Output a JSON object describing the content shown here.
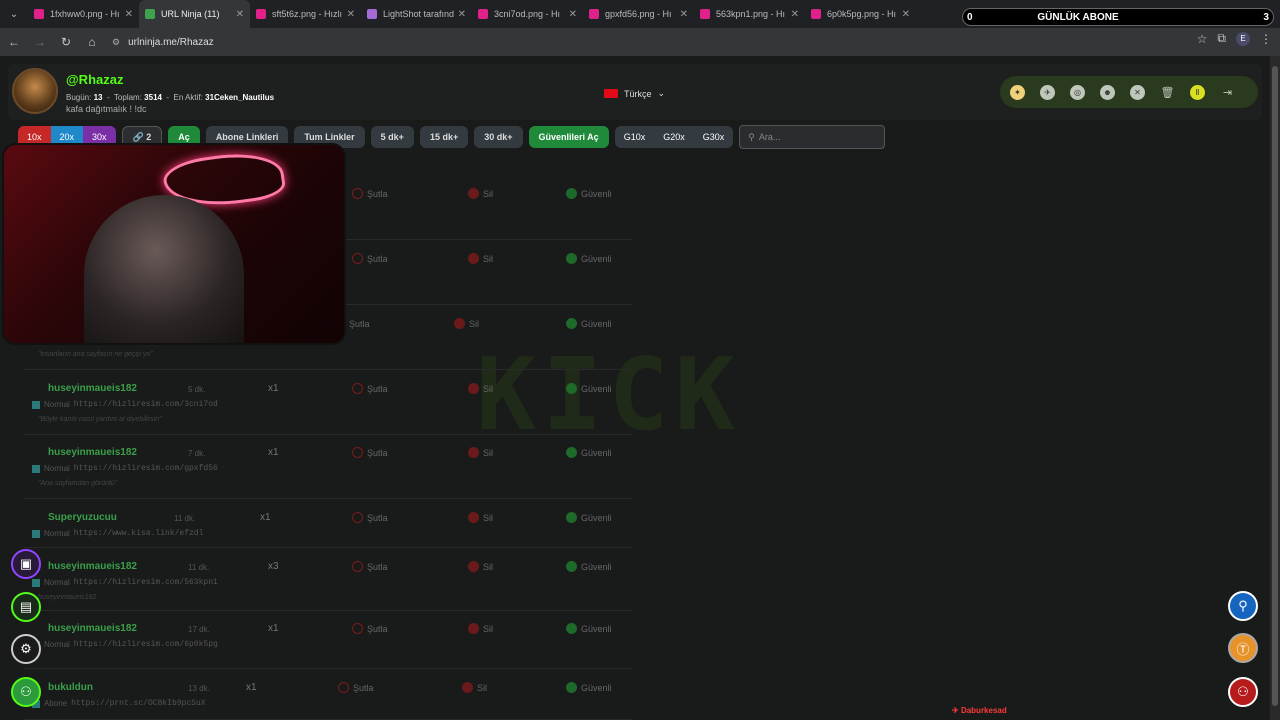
{
  "tabs": [
    {
      "title": "1fxhww0.png - Hı",
      "color": "#e0218a"
    },
    {
      "title": "URL Ninja (11)",
      "color": "#3fa34d",
      "active": true
    },
    {
      "title": "sft5t6z.png - Hızlı",
      "color": "#e0218a"
    },
    {
      "title": "LightShot tarafınd",
      "color": "#a46ad6"
    },
    {
      "title": "3cni7od.png - Hı",
      "color": "#e0218a"
    },
    {
      "title": "gpxfd56.png - Hı",
      "color": "#e0218a"
    },
    {
      "title": "563kpn1.png - Hı",
      "color": "#e0218a"
    },
    {
      "title": "6p0k5pg.png - Hı",
      "color": "#e0218a"
    }
  ],
  "browser": {
    "url": "urlninja.me/Rhazaz",
    "profile": "E"
  },
  "banner": {
    "left": "0",
    "title": "GÜNLÜK ABONE",
    "right": "3"
  },
  "profile": {
    "username": "@Rhazaz",
    "today_label": "Bugün:",
    "today": "13",
    "total_label": "Toplam:",
    "total": "3514",
    "active_label": "En Aktif:",
    "active": "31Ceken_Nautilus",
    "bio": "kafa dağıtmalık ! !dc",
    "language": "Türkçe"
  },
  "toolbar": {
    "speeds": [
      "10x",
      "20x",
      "30x"
    ],
    "link_count": "2",
    "open": "Aç",
    "sub_links": "Abone Linkleri",
    "all_links": "Tum Linkler",
    "t5": "5 dk+",
    "t15": "15 dk+",
    "t30": "30 dk+",
    "open_safe": "Güvenlileri Aç",
    "g10": "G10x",
    "g20": "G20x",
    "g30": "G30x",
    "search_placeholder": "Ara..."
  },
  "watermark": "KICK",
  "actions": {
    "skip": "Şutla",
    "delete": "Sil",
    "safe": "Güvenli"
  },
  "rows": [
    {
      "user": "",
      "time": "",
      "mult": "",
      "tag": "",
      "link": "",
      "msg": ""
    },
    {
      "user": "",
      "time": "",
      "mult": "",
      "tag": "",
      "link": "",
      "msg": ""
    },
    {
      "user": "",
      "time": "",
      "mult": "",
      "tag": "Abone",
      "link": "https://prnt.sc/11C184D9WfEQ",
      "msg": "\"insanların ana sayfasın ne geçip yo\""
    },
    {
      "user": "huseyinmaueis182",
      "time": "5 dk.",
      "mult": "x1",
      "tag": "Normal",
      "link": "https://hizliresim.com/3cni7od",
      "msg": "\"Böyle kanıtı nasıl yardım al diyebilirsin\""
    },
    {
      "user": "huseyinmaueis182",
      "time": "7 dk.",
      "mult": "x1",
      "tag": "Normal",
      "link": "https://hizliresim.com/gpxfd56",
      "msg": "\"Ana sayfamdan görüntü\""
    },
    {
      "user": "Superyuzucuu",
      "time": "11 dk.",
      "mult": "x1",
      "tag": "Normal",
      "link": "https://www.kisa.link/efzdl",
      "msg": ""
    },
    {
      "user": "huseyinmaueis182",
      "time": "11 dk.",
      "mult": "x3",
      "tag": "Normal",
      "link": "https://hizliresim.com/563kpn1",
      "msg": "huseyinmaueis182"
    },
    {
      "user": "huseyinmaueis182",
      "time": "17 dk.",
      "mult": "x1",
      "tag": "Normal",
      "link": "https://hizliresim.com/6p0k5pg",
      "msg": ""
    },
    {
      "user": "bukuldun",
      "time": "13 dk.",
      "mult": "x1",
      "tag": "Abone",
      "link": "https://prnt.sc/OC8kIb9pcSuX",
      "msg": ""
    }
  ],
  "footnote": "Daburkesad",
  "colors": {
    "accent": "#53fc18",
    "green_btn": "#1f8a3a",
    "red": "#d11f2b"
  }
}
